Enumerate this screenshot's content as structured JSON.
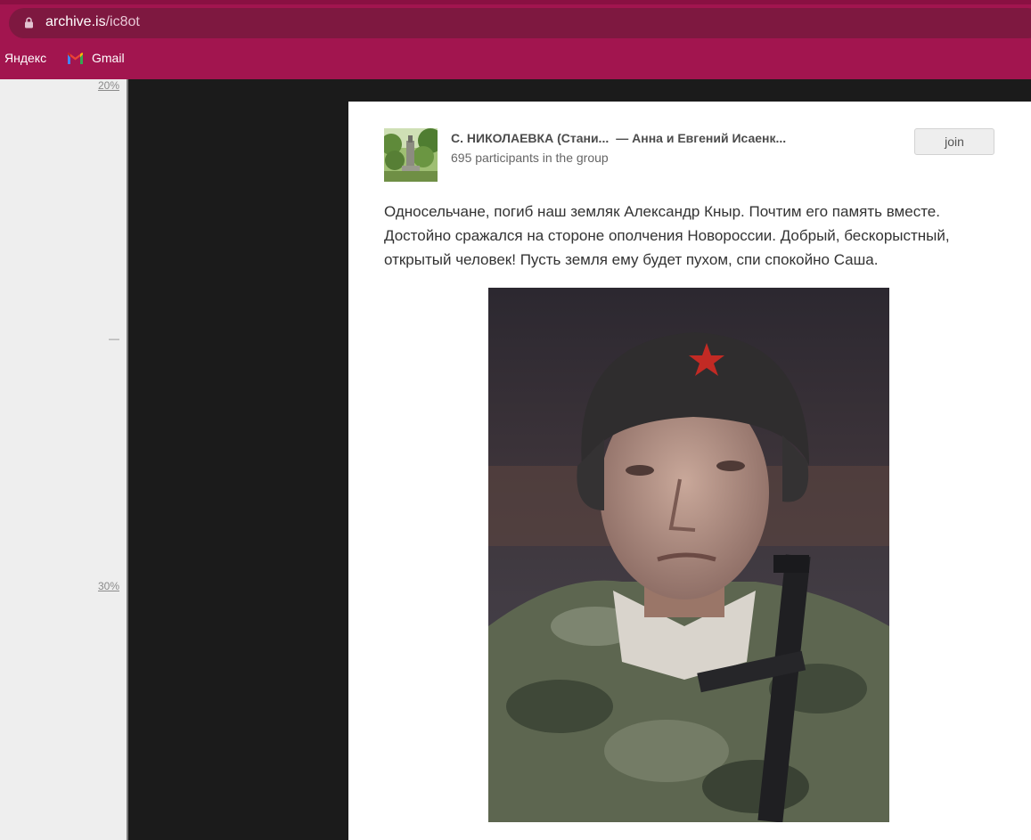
{
  "browser": {
    "url_host": "archive.is",
    "url_path": "/ic8ot",
    "bookmarks": [
      {
        "label": "Яндекс"
      },
      {
        "label": "Gmail"
      }
    ]
  },
  "scale": {
    "labels": [
      "20%",
      "—",
      "30%"
    ]
  },
  "post": {
    "group_title": "С. НИКОЛАЕВКА (Стани...",
    "group_author": "— Анна и Евгений Исаенк...",
    "participants": "695 participants in the group",
    "join_label": "join",
    "text": "Односельчане, погиб наш земляк Александр Кныр. Почтим его память вместе. Достойно сражался на стороне ополчения Новороссии. Добрый, бескорыстный, открытый человек! Пусть земля ему будет пухом, спи спокойно Саша."
  },
  "colors": {
    "chrome": "#a2154f",
    "urlbar": "#7e1840",
    "page_bg": "#1b1b1b",
    "scale_bg": "#eeeeee"
  }
}
